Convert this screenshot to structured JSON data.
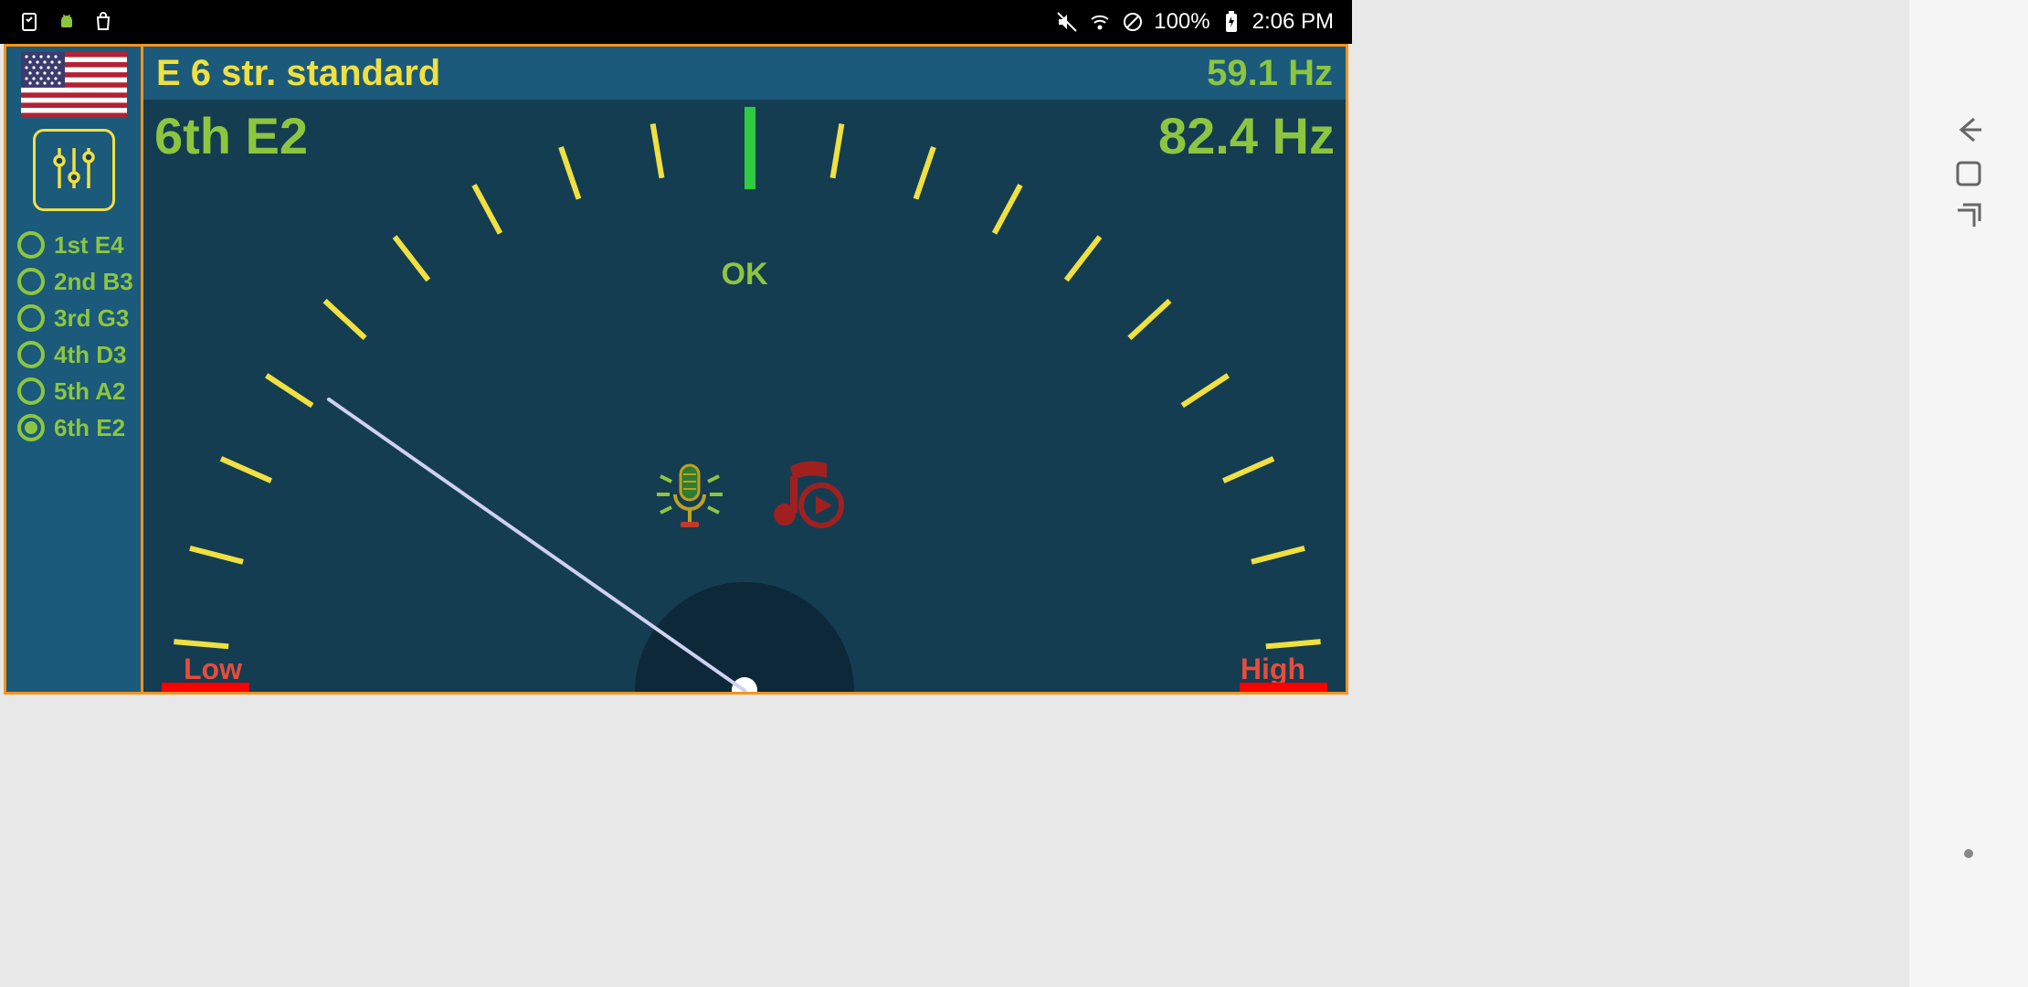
{
  "status": {
    "battery": "100%",
    "time": "2:06 PM"
  },
  "header": {
    "tuning_name": "E 6 str. standard",
    "current_hz": "59.1 Hz"
  },
  "note": {
    "label": "6th E2",
    "target_hz": "82.4 Hz"
  },
  "gauge": {
    "ok_label": "OK",
    "low_label": "Low",
    "high_label": "High"
  },
  "strings": [
    {
      "label": "1st E4",
      "selected": false
    },
    {
      "label": "2nd B3",
      "selected": false
    },
    {
      "label": "3rd G3",
      "selected": false
    },
    {
      "label": "4th D3",
      "selected": false
    },
    {
      "label": "5th A2",
      "selected": false
    },
    {
      "label": "6th E2",
      "selected": true
    }
  ],
  "chart_data": {
    "type": "gauge",
    "title": "Tuner needle (detected vs target frequency)",
    "target_hz": 82.4,
    "detected_hz": 59.1,
    "needle_angle_deg": -55,
    "tick_range_deg": [
      -85,
      85
    ],
    "tick_count": 19,
    "center_label": "OK",
    "low_label": "Low",
    "high_label": "High"
  }
}
